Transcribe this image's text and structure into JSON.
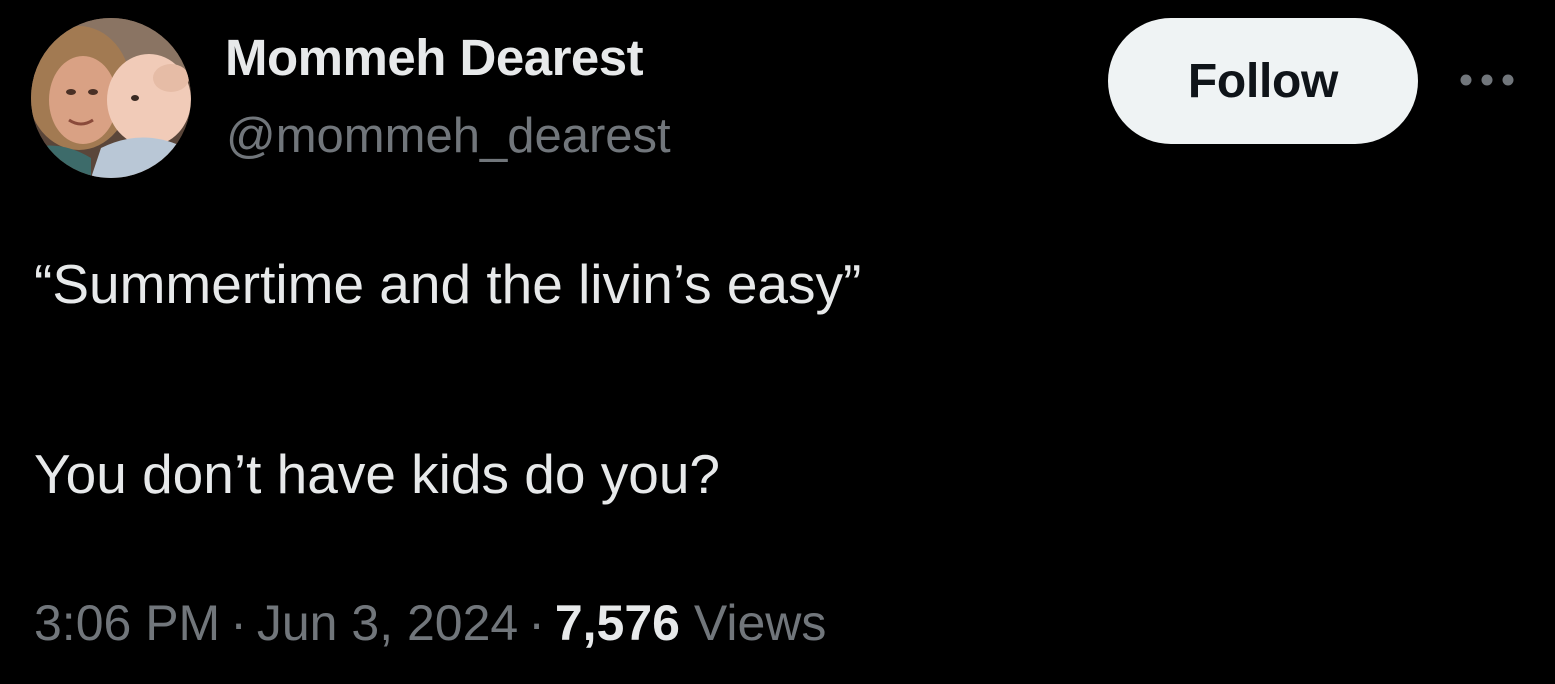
{
  "user": {
    "display_name": "Mommeh Dearest",
    "handle": "@mommeh_dearest",
    "avatar_icon": "profile-photo"
  },
  "actions": {
    "follow_label": "Follow",
    "more_icon": "more-horizontal-icon"
  },
  "tweet": {
    "line1": "“Summertime and the livin’s easy”",
    "line2": "You don’t have kids do you?"
  },
  "meta": {
    "time": "3:06 PM",
    "separator": "·",
    "date": "Jun 3, 2024",
    "views_count": "7,576",
    "views_label": "Views"
  },
  "colors": {
    "background": "#000000",
    "primary_text": "#e7e9ea",
    "secondary_text": "#71767b",
    "follow_bg": "#eff3f4",
    "follow_text": "#0f1419"
  }
}
